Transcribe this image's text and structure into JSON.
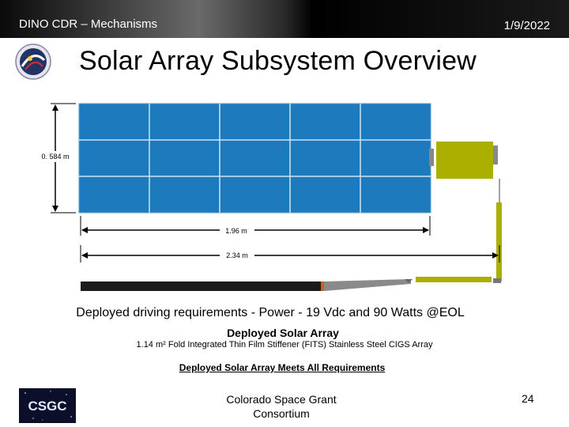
{
  "header": {
    "left_text": "DINO CDR – Mechanisms",
    "date": "1/9/2022"
  },
  "title": "Solar Array Subsystem Overview",
  "diagram": {
    "height_label": "0. 584 m",
    "width_label_panel": "1.96 m",
    "width_label_total": "2.34 m",
    "colors": {
      "panel": "#1d7bbd",
      "panel_border": "#cfe3f3",
      "stiffener": "#aaaf00",
      "bar_dark": "#1c1c1c",
      "bar_orange": "#d95a1c",
      "bar_gray": "#8a8a8a"
    }
  },
  "requirements": {
    "line1": "Deployed driving requirements - Power - 19 Vdc and 90 Watts @EOL",
    "line2": "Deployed Solar Array",
    "line3": "1.14 m² Fold Integrated Thin Film Stiffener (FITS) Stainless Steel CIGS Array",
    "line4": "Deployed Solar Array Meets All Requirements"
  },
  "footer": {
    "logo_text": "CSGC",
    "center_line1": "Colorado Space Grant",
    "center_line2": "Consortium",
    "page_number": "24"
  }
}
